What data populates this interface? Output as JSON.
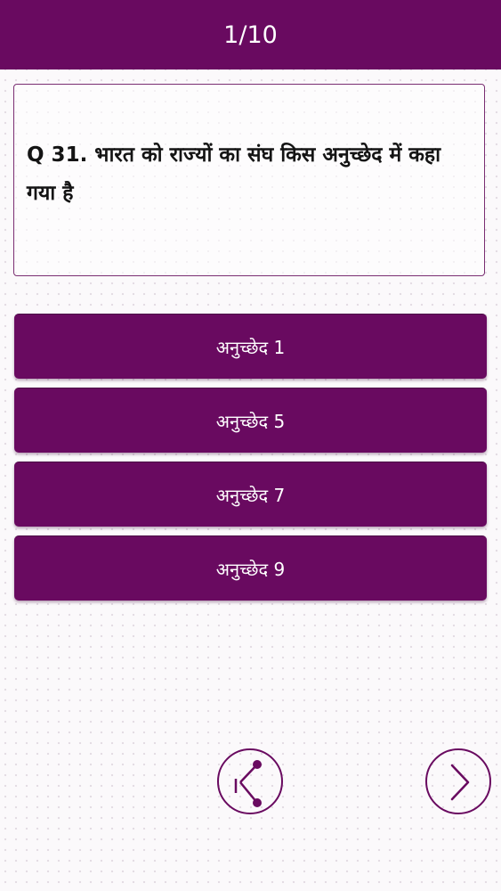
{
  "header": {
    "title": "1/10"
  },
  "question": {
    "text": "Q 31. भारत को राज्यों का संघ किस अनुच्छेद में कहा गया है"
  },
  "options": [
    {
      "label": "अनुच्छेद 1"
    },
    {
      "label": "अनुच्छेद 5"
    },
    {
      "label": "अनुच्छेद 7"
    },
    {
      "label": "अनुच्छेद 9"
    }
  ],
  "nav": {
    "share_icon": "share-icon",
    "next_icon": "chevron-right-icon"
  },
  "colors": {
    "primary": "#690a60",
    "background": "#fbf9fb",
    "text_on_primary": "#ffffff",
    "question_text": "#141414"
  }
}
